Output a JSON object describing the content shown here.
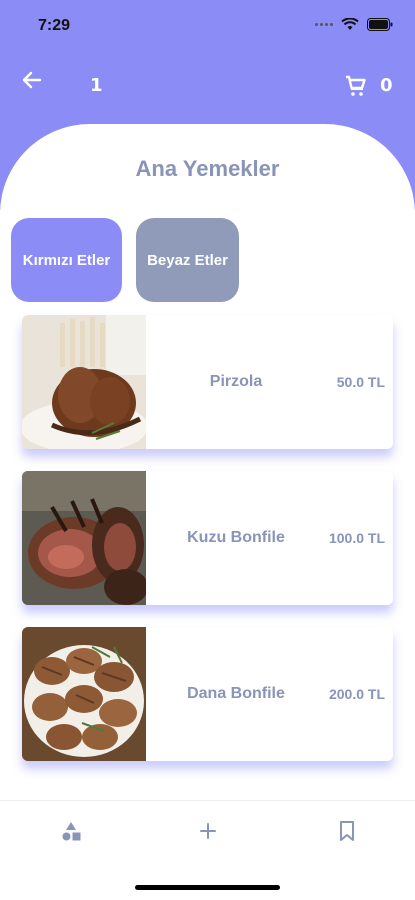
{
  "status": {
    "time": "7:29"
  },
  "app_bar": {
    "counter": "1",
    "cart_count": "0"
  },
  "page": {
    "title": "Ana Yemekler"
  },
  "categories": [
    {
      "label": "Kırmızı Etler"
    },
    {
      "label": "Beyaz Etler"
    }
  ],
  "items": [
    {
      "name": "Pirzola",
      "price": "50.0 TL"
    },
    {
      "name": "Kuzu Bonfile",
      "price": "100.0 TL"
    },
    {
      "name": "Dana Bonfile",
      "price": "200.0 TL"
    }
  ],
  "icons": {
    "back": "arrow-left-icon",
    "cart": "shopping-cart-icon",
    "nav": [
      "shapes-icon",
      "plus-icon",
      "bookmark-icon"
    ]
  },
  "colors": {
    "accent": "#8c8cf7",
    "secondary": "#8f9bb8",
    "text": "#8a93b8"
  }
}
